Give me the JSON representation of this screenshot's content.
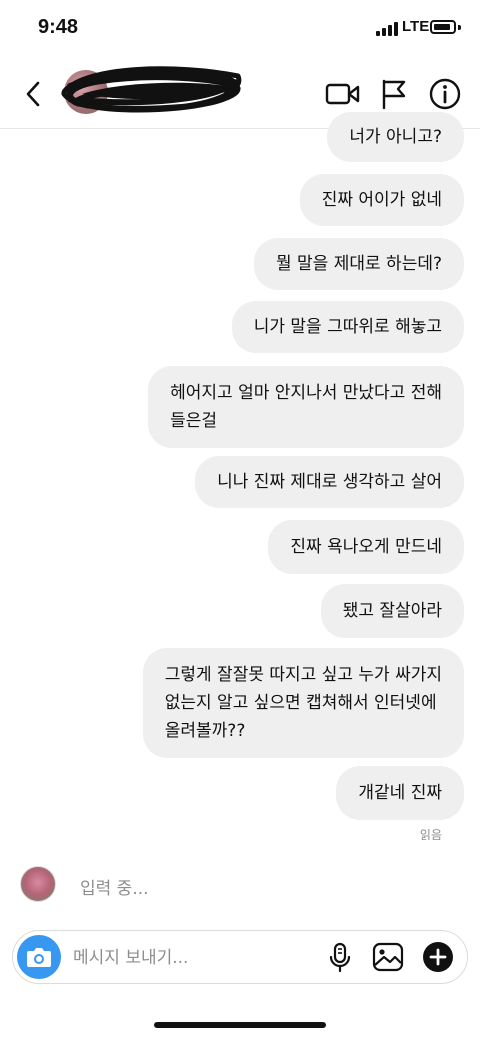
{
  "status_bar": {
    "time": "9:48",
    "network": "LTE",
    "icons": [
      "signal-icon",
      "battery-icon"
    ]
  },
  "header": {
    "username": "",
    "active_status": "",
    "icons": [
      "back-icon",
      "video-call-icon",
      "flag-icon",
      "info-icon"
    ]
  },
  "messages": [
    {
      "text": "너가 아니고?",
      "sender": "me"
    },
    {
      "text": "진짜 어이가 없네",
      "sender": "me"
    },
    {
      "text": "뭘 말을 제대로 하는데?",
      "sender": "me"
    },
    {
      "text": "니가 말을 그따위로 해놓고",
      "sender": "me"
    },
    {
      "text": "헤어지고 얼마 안지나서 만났다고 전해\n들은걸",
      "sender": "me"
    },
    {
      "text": "니나 진짜 제대로 생각하고 살어",
      "sender": "me"
    },
    {
      "text": "진짜 욕나오게 만드네",
      "sender": "me"
    },
    {
      "text": "됐고 잘살아라",
      "sender": "me"
    },
    {
      "text": "그렇게 잘잘못 따지고 싶고 누가 싸가지\n없는지 알고 싶으면 캡쳐해서 인터넷에\n올려볼까??",
      "sender": "me"
    },
    {
      "text": "개같네 진짜",
      "sender": "me"
    }
  ],
  "read_receipt": "읽음",
  "typing_indicator": "입력 중...",
  "composer": {
    "placeholder": "메시지 보내기...",
    "value": "",
    "icons": [
      "camera-icon",
      "microphone-icon",
      "gallery-icon",
      "add-icon"
    ]
  },
  "colors": {
    "bubble": "#efefef",
    "camera_button": "#3897f0",
    "secondary_text": "#8e8e8e"
  }
}
